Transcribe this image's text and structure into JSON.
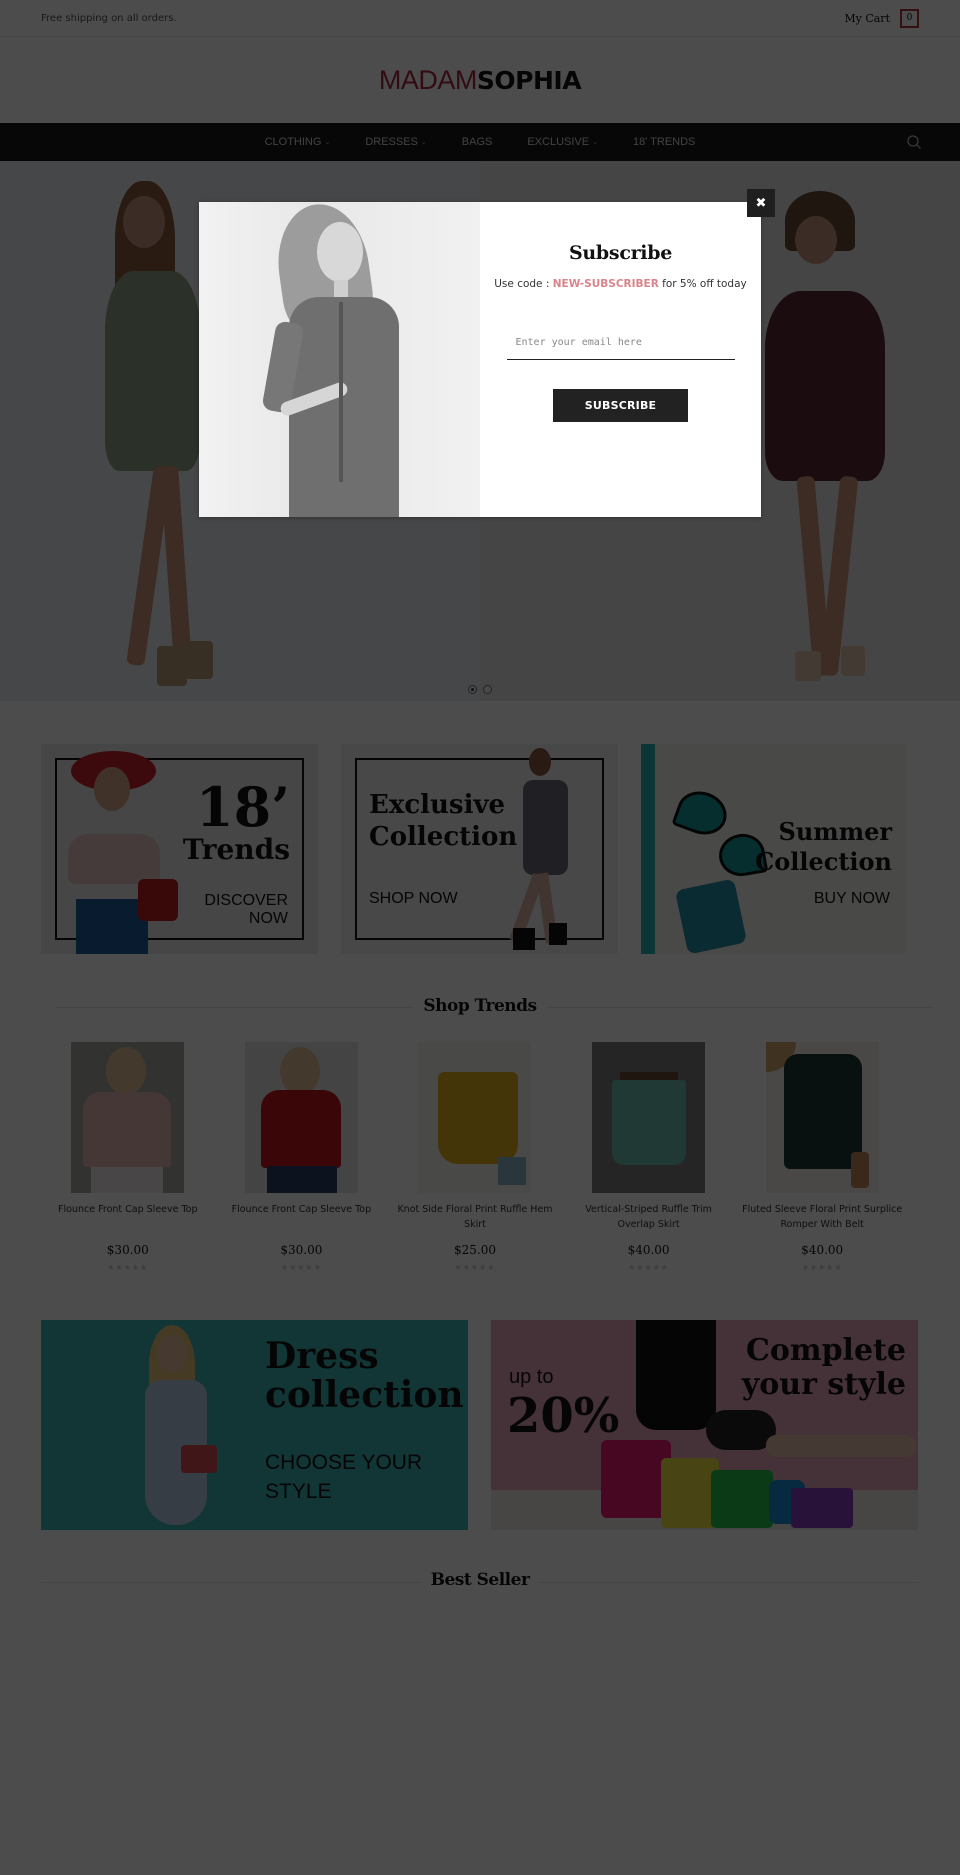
{
  "topbar": {
    "shipping_text": "Free shipping on all orders.",
    "cart_label": "My Cart",
    "cart_count": "0"
  },
  "logo": {
    "part1": "MADAM",
    "part2": "SOPHIA",
    "accent_color": "#a8283f"
  },
  "nav": {
    "items": [
      {
        "label": "CLOTHING",
        "has_dropdown": true
      },
      {
        "label": "DRESSES",
        "has_dropdown": true
      },
      {
        "label": "BAGS",
        "has_dropdown": false
      },
      {
        "label": "EXCLUSIVE",
        "has_dropdown": true
      },
      {
        "label": "18' TRENDS",
        "has_dropdown": false
      }
    ],
    "search_icon": "search-icon"
  },
  "hero": {
    "slides": 2,
    "active_slide": 1
  },
  "promos": [
    {
      "title_line1": "18’",
      "title_line2": "Trends",
      "cta_line1": "DISCOVER",
      "cta_line2": "NOW"
    },
    {
      "title_line1": "Exclusive",
      "title_line2": "Collection",
      "cta": "SHOP NOW"
    },
    {
      "title_line1": "Summer",
      "title_line2": "Collection",
      "cta": "BUY NOW"
    }
  ],
  "shop_trends": {
    "title": "Shop Trends",
    "products": [
      {
        "name": "Flounce Front Cap Sleeve Top",
        "price": "$30.00",
        "rating": 0
      },
      {
        "name": "Flounce Front Cap Sleeve Top",
        "price": "$30.00",
        "rating": 0
      },
      {
        "name": "Knot Side Floral Print Ruffle Hem Skirt",
        "price": "$25.00",
        "rating": 0
      },
      {
        "name": "Vertical-Striped Ruffle Trim Overlap Skirt",
        "price": "$40.00",
        "rating": 0
      },
      {
        "name": "Fluted Sleeve Floral Print Surplice Romper With Belt",
        "price": "$40.00",
        "rating": 0
      }
    ],
    "stars": "★★★★★"
  },
  "big_banners": [
    {
      "title_line1": "Dress",
      "title_line2": "collection",
      "sub_line1": "CHOOSE YOUR",
      "sub_line2": "STYLE"
    },
    {
      "pre": "up to",
      "percent": "20%",
      "title_line1": "Complete",
      "title_line2": "your style"
    }
  ],
  "best_seller": {
    "title": "Best Seller"
  },
  "modal": {
    "title": "Subscribe",
    "desc_prefix": "Use code : ",
    "code": "NEW-SUBSCRIBER",
    "desc_suffix": " for 5% off today",
    "email_placeholder": "Enter your email here",
    "email_value": "",
    "button_label": "SUBSCRIBE",
    "close_glyph": "✖",
    "code_color": "#d9848a"
  }
}
